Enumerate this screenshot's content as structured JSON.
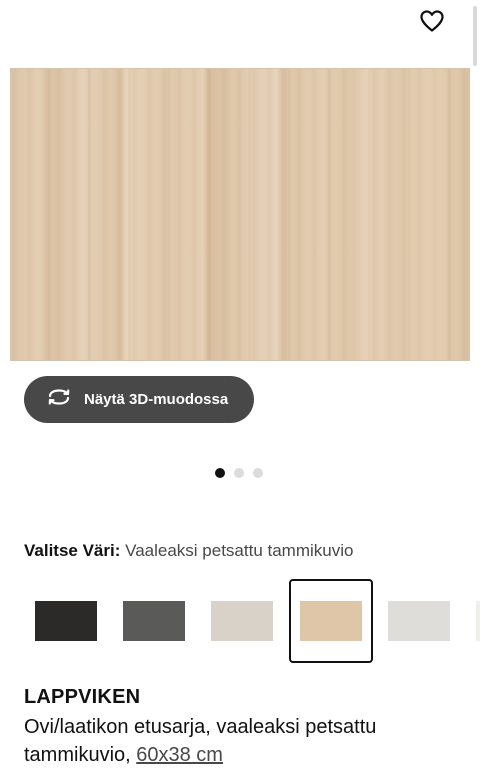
{
  "header": {
    "favorite_icon": "heart-outline-icon"
  },
  "gallery": {
    "image_alt": "",
    "pagination": {
      "total": 3,
      "active": 1
    }
  },
  "view3d": {
    "icon": "rotate-arrows-icon",
    "label": "Näytä 3D-muodossa"
  },
  "color_picker": {
    "heading": "Valitse Väri:",
    "selected_value": "Vaaleaksi petsattu tammikuvio",
    "swatches": [
      {
        "color": "#2c2a28"
      },
      {
        "color": "#5a5b58"
      },
      {
        "color": "#d8d2c8"
      },
      {
        "color": "#e0c6a8",
        "selected": true
      },
      {
        "color": "#deddd9"
      },
      {
        "color": "#f1efea"
      }
    ]
  },
  "product": {
    "name": "LAPPVIKEN",
    "description_prefix": "Ovi/laatikon etusarja, vaaleaksi petsattu tammikuvio, ",
    "size": "60x38 cm"
  }
}
